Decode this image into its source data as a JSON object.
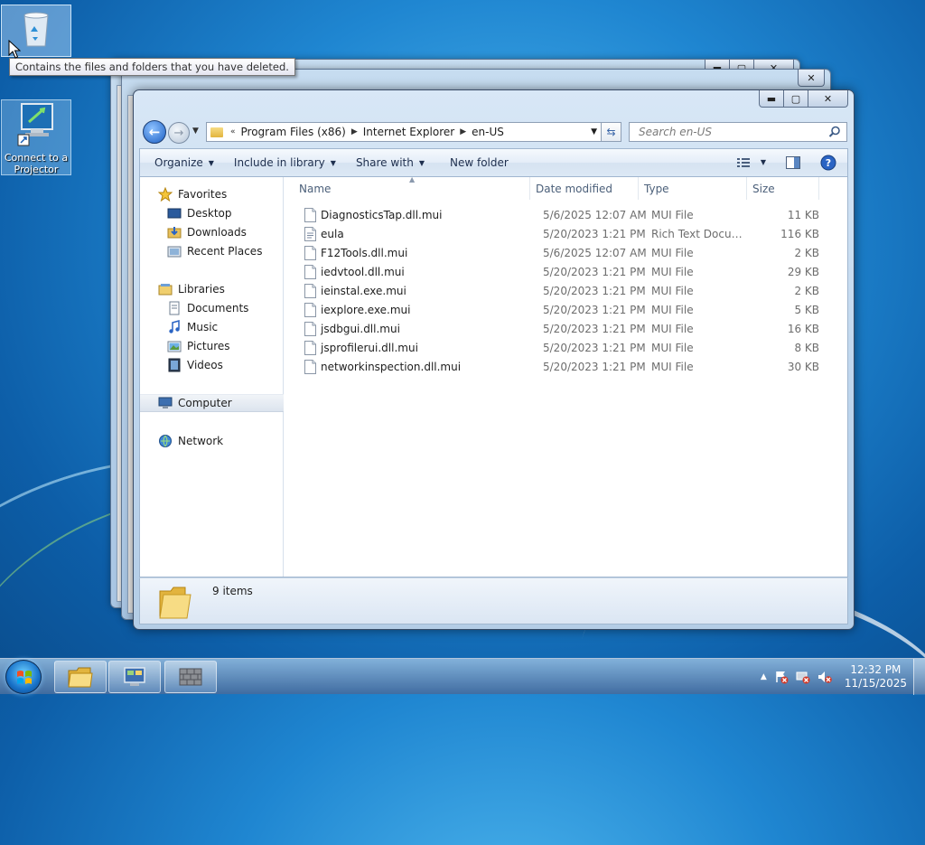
{
  "desktop": {
    "icons": [
      {
        "label": "Recycle Bin"
      },
      {
        "label": "Connect to a Projector"
      }
    ],
    "tooltip": "Contains the files and folders that you have deleted."
  },
  "window": {
    "address": {
      "overflow": "«",
      "crumbs": [
        "Program Files (x86)",
        "Internet Explorer",
        "en-US"
      ]
    },
    "search": {
      "placeholder": "Search en-US"
    },
    "toolbar": {
      "organize": "Organize",
      "include_in_library": "Include in library",
      "share_with": "Share with",
      "new_folder": "New folder"
    },
    "nav": {
      "favorites": "Favorites",
      "desktop": "Desktop",
      "downloads": "Downloads",
      "recent_places": "Recent Places",
      "libraries": "Libraries",
      "documents": "Documents",
      "music": "Music",
      "pictures": "Pictures",
      "videos": "Videos",
      "computer": "Computer",
      "network": "Network"
    },
    "columns": {
      "name": "Name",
      "date_modified": "Date modified",
      "type": "Type",
      "size": "Size"
    },
    "files": [
      {
        "name": "DiagnosticsTap.dll.mui",
        "date": "5/6/2025 12:07 AM",
        "type": "MUI File",
        "size": "11 KB"
      },
      {
        "name": "eula",
        "date": "5/20/2023 1:21 PM",
        "type": "Rich Text Docume...",
        "size": "116 KB"
      },
      {
        "name": "F12Tools.dll.mui",
        "date": "5/6/2025 12:07 AM",
        "type": "MUI File",
        "size": "2 KB"
      },
      {
        "name": "iedvtool.dll.mui",
        "date": "5/20/2023 1:21 PM",
        "type": "MUI File",
        "size": "29 KB"
      },
      {
        "name": "ieinstal.exe.mui",
        "date": "5/20/2023 1:21 PM",
        "type": "MUI File",
        "size": "2 KB"
      },
      {
        "name": "iexplore.exe.mui",
        "date": "5/20/2023 1:21 PM",
        "type": "MUI File",
        "size": "5 KB"
      },
      {
        "name": "jsdbgui.dll.mui",
        "date": "5/20/2023 1:21 PM",
        "type": "MUI File",
        "size": "16 KB"
      },
      {
        "name": "jsprofilerui.dll.mui",
        "date": "5/20/2023 1:21 PM",
        "type": "MUI File",
        "size": "8 KB"
      },
      {
        "name": "networkinspection.dll.mui",
        "date": "5/20/2023 1:21 PM",
        "type": "MUI File",
        "size": "30 KB"
      }
    ],
    "status": {
      "item_count": "9 items"
    }
  },
  "taskbar": {
    "time": "12:32 PM",
    "date": "11/15/2025"
  },
  "colors": {
    "close_red": "#c9513a",
    "selection": "#dce4ee",
    "folder_yellow": "#e2b43e"
  }
}
